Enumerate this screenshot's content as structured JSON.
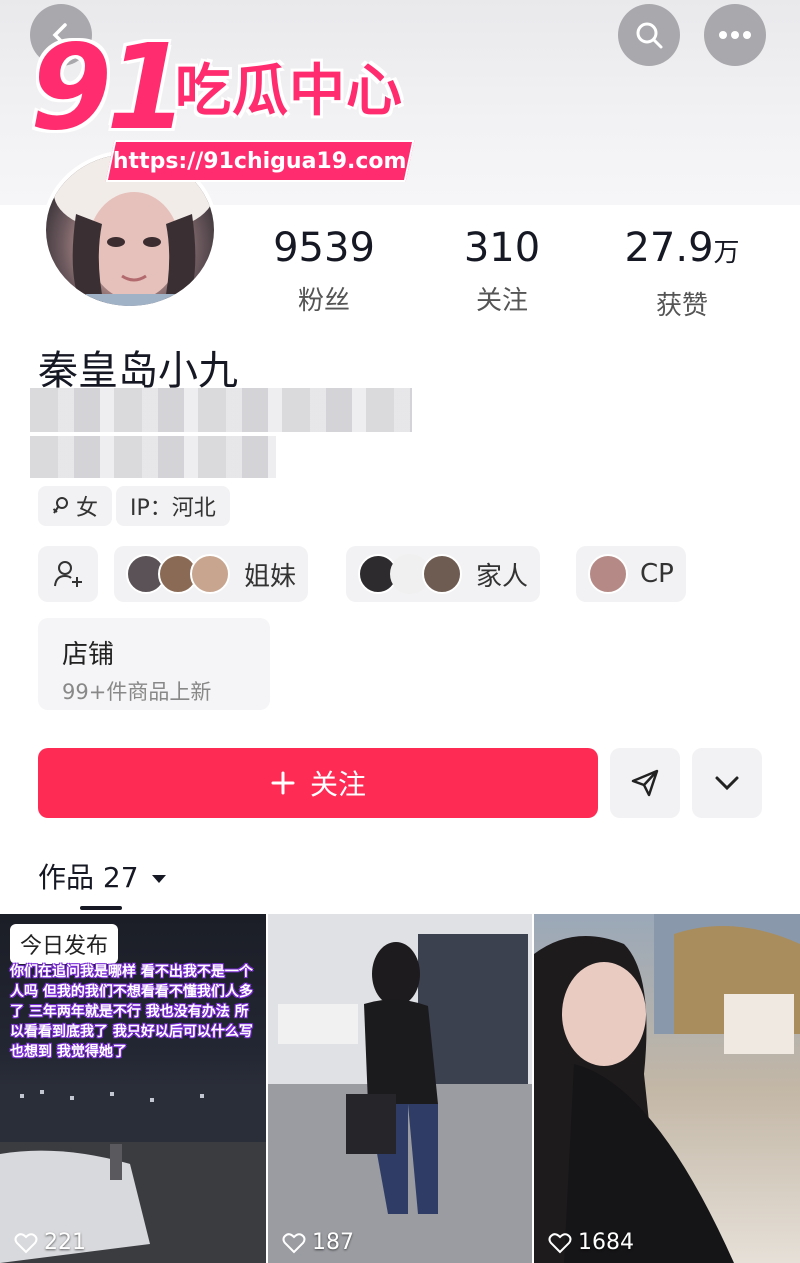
{
  "watermark": {
    "logo_num": "91",
    "logo_text": "吃瓜中心",
    "url": "https://91chigua19.com"
  },
  "profile": {
    "name": "秦皇岛小九",
    "stats": [
      {
        "num": "9539",
        "unit": "",
        "label": "粉丝"
      },
      {
        "num": "310",
        "unit": "",
        "label": "关注"
      },
      {
        "num": "27.9",
        "unit": "万",
        "label": "获赞"
      }
    ],
    "gender_tag": "女",
    "ip_tag": "IP：河北",
    "relations": [
      {
        "label": "姐妹"
      },
      {
        "label": "家人"
      },
      {
        "label": "CP"
      }
    ],
    "shop": {
      "title": "店铺",
      "subtitle": "99+件商品上新"
    },
    "follow_label": "关注",
    "works_tab": "作品 27"
  },
  "works": [
    {
      "badge": "今日发布",
      "likes": "221",
      "caption": "你们在追问我是哪样 看不出我不是一个人吗 但我的我们不想看看不懂我们人多了 三年两年就是不行 我也没有办法 所以看看到底我了 我只好以后可以什么写 也想到 我觉得她了"
    },
    {
      "badge": "",
      "likes": "187",
      "caption": ""
    },
    {
      "badge": "",
      "likes": "1684",
      "caption": ""
    }
  ],
  "colors": {
    "accent": "#fe2c55",
    "watermark": "#ff2d6f"
  }
}
